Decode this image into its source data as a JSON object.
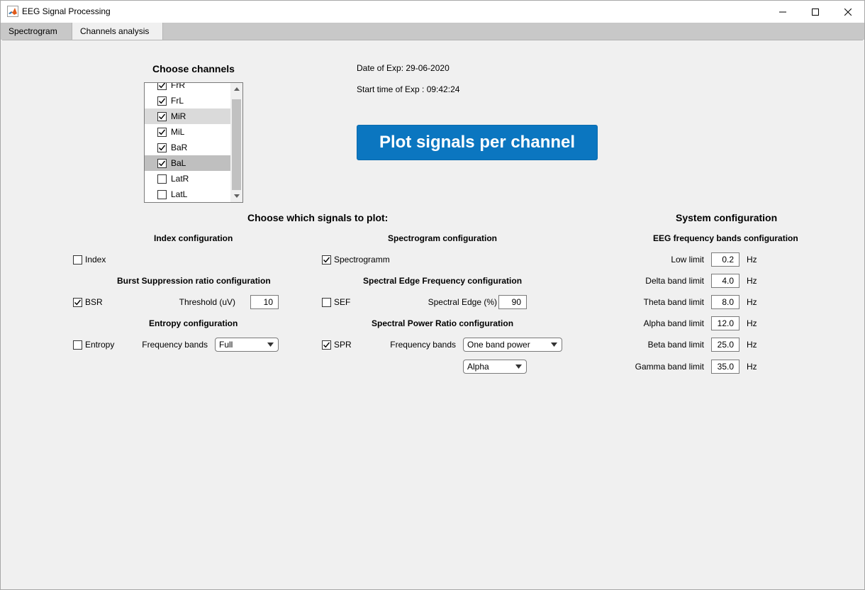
{
  "window": {
    "title": "EEG Signal Processing"
  },
  "tabs": [
    {
      "label": "Spectrogram",
      "active": false
    },
    {
      "label": "Channels analysis",
      "active": true
    }
  ],
  "channels": {
    "heading": "Choose channels",
    "items": [
      {
        "label": "FrR",
        "checked": true
      },
      {
        "label": "FrL",
        "checked": true
      },
      {
        "label": "MiR",
        "checked": true
      },
      {
        "label": "MiL",
        "checked": true
      },
      {
        "label": "BaR",
        "checked": true
      },
      {
        "label": "BaL",
        "checked": true
      },
      {
        "label": "LatR",
        "checked": false
      },
      {
        "label": "LatL",
        "checked": false
      }
    ]
  },
  "experiment": {
    "date": "Date of Exp: 29-06-2020",
    "start_time": "Start time of Exp : 09:42:24"
  },
  "plot_button": "Plot signals per channel",
  "signals": {
    "heading": "Choose which signals to plot:",
    "index": {
      "heading": "Index configuration",
      "checkbox_label": "Index",
      "checked": false
    },
    "bsr": {
      "heading": "Burst Suppression ratio configuration",
      "checkbox_label": "BSR",
      "checked": true,
      "threshold_label": "Threshold (uV)",
      "threshold_value": "10"
    },
    "entropy": {
      "heading": "Entropy configuration",
      "checkbox_label": "Entropy",
      "checked": false,
      "bands_label": "Frequency bands",
      "bands_value": "Full"
    },
    "spectrogram": {
      "heading": "Spectrogram configuration",
      "checkbox_label": "Spectrogramm",
      "checked": true
    },
    "sef": {
      "heading": "Spectral Edge Frequency configuration",
      "checkbox_label": "SEF",
      "checked": false,
      "edge_label": "Spectral Edge (%)",
      "edge_value": "90"
    },
    "spr": {
      "heading": "Spectral Power Ratio configuration",
      "checkbox_label": "SPR",
      "checked": true,
      "bands_label": "Frequency bands",
      "mode_value": "One band power",
      "band_value": "Alpha"
    }
  },
  "system": {
    "heading": "System configuration",
    "subheading": "EEG frequency bands configuration",
    "unit": "Hz",
    "bands": [
      {
        "label": "Low limit",
        "value": "0.2"
      },
      {
        "label": "Delta band limit",
        "value": "4.0"
      },
      {
        "label": "Theta band limit",
        "value": "8.0"
      },
      {
        "label": "Alpha band limit",
        "value": "12.0"
      },
      {
        "label": "Beta band limit",
        "value": "25.0"
      },
      {
        "label": "Gamma band limit",
        "value": "35.0"
      }
    ]
  },
  "colors": {
    "accent": "#0b76c0",
    "background": "#f0f0f0",
    "tabstrip": "#c8c8c8"
  }
}
